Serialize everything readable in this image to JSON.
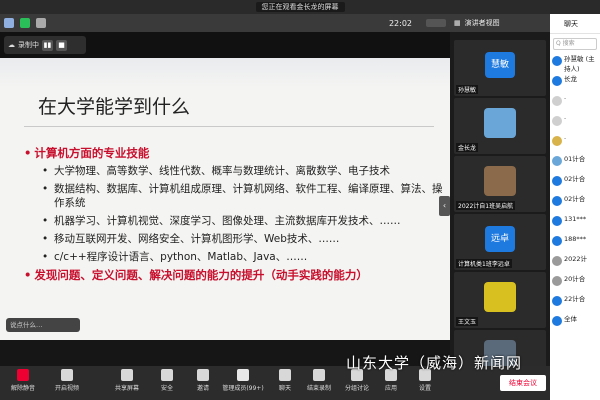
{
  "banner": {
    "text": "您正在观看金长龙的屏幕"
  },
  "topbar": {
    "time": "22:02"
  },
  "right_header": {
    "view_label": "演讲者视图"
  },
  "recording": {
    "label": "录制中",
    "pause": "▮▮",
    "stop": "■"
  },
  "slide": {
    "title": "在大学能学到什么",
    "heading": "计算机方面的专业技能",
    "bullets": [
      "大学物理、高等数学、线性代数、概率与数理统计、离散数学、电子技术",
      "数据结构、数据库、计算机组成原理、计算机网络、软件工程、编译原理、算法、操作系统",
      "机器学习、计算机视觉、深度学习、图像处理、主流数据库开发技术、……",
      "移动互联网开发、网络安全、计算机图形学、Web技术、……",
      "c/c++程序设计语言、python、Matlab、Java、……"
    ],
    "highlight": "发现问题、定义问题、解决问题的能力的提升（动手实践的能力）"
  },
  "comment_box": {
    "placeholder": "说点什么…"
  },
  "participants": [
    {
      "name": "孙慧敏",
      "avatar": "慧敏",
      "color": "#1f7ae0"
    },
    {
      "name": "金长龙",
      "avatar": "",
      "color": "#6aa7d8"
    },
    {
      "name": "2022计自1班吴启航",
      "avatar": "",
      "color": "#8a6a4a"
    },
    {
      "name": "计算机类1班李远卓",
      "avatar": "远卓",
      "color": "#1f7ae0"
    },
    {
      "name": "王文玉",
      "avatar": "",
      "color": "#d8c020"
    },
    {
      "name": "",
      "avatar": "",
      "color": "#5a6a7a"
    }
  ],
  "chat": {
    "title": "聊天",
    "search_placeholder": "Q 搜索",
    "messages": [
      {
        "text": "孙慧敏 (主持人)",
        "color": "#1f7ae0"
      },
      {
        "text": "长龙",
        "color": "#1f7ae0"
      },
      {
        "text": "·",
        "color": "#cfcfcf"
      },
      {
        "text": "·",
        "color": "#cfcfcf"
      },
      {
        "text": "·",
        "color": "#d8b24a"
      },
      {
        "text": "01计合",
        "color": "#6aa7d8"
      },
      {
        "text": "02计合",
        "color": "#1f7ae0"
      },
      {
        "text": "02计合",
        "color": "#1f7ae0"
      },
      {
        "text": "131***",
        "color": "#1f7ae0"
      },
      {
        "text": "188***",
        "color": "#1f7ae0"
      },
      {
        "text": "2022计",
        "color": "#9a9a9a"
      },
      {
        "text": "20计合",
        "color": "#9a9a9a"
      },
      {
        "text": "22计合",
        "color": "#1f7ae0"
      },
      {
        "text": "全体",
        "color": "#1f7ae0"
      }
    ]
  },
  "toolbar": [
    {
      "label": "解除静音"
    },
    {
      "label": "开启视频"
    },
    {
      "label": "共享屏幕"
    },
    {
      "label": "安全"
    },
    {
      "label": "邀请"
    },
    {
      "label": "管理成员(99+)"
    },
    {
      "label": "聊天"
    },
    {
      "label": "结束录制"
    },
    {
      "label": "分组讨论"
    },
    {
      "label": "应用"
    },
    {
      "label": "设置"
    }
  ],
  "end_meeting": "结束会议",
  "watermark": "山东大学（威海）新闻网"
}
